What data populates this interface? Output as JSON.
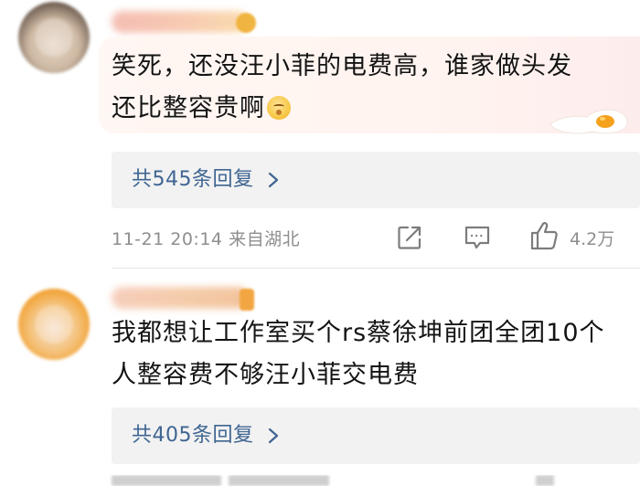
{
  "comments": [
    {
      "text_line1": "笑死，还没汪小菲的电费高，谁家做头发",
      "text_line2": "还比整容贵啊",
      "emoji": "shush-face-emoji",
      "reply_label": "共545条回复",
      "timestamp": "11-21 20:14",
      "location": "来自湖北",
      "like_count": "4.2万"
    },
    {
      "text_line1": "我都想让工作室买个rs蔡徐坤前团全团10个",
      "text_line2": "人整容费不够汪小菲交电费",
      "reply_label": "共405条回复"
    }
  ],
  "icons": {
    "share": "share-icon",
    "comment": "comment-icon",
    "like": "thumbs-up-icon",
    "chevron": "chevron-right-icon"
  },
  "colors": {
    "reply_link": "#3f6592",
    "meta_text": "#8e8e8e",
    "reply_bg": "#f2f2f2",
    "body_text": "#141414"
  }
}
